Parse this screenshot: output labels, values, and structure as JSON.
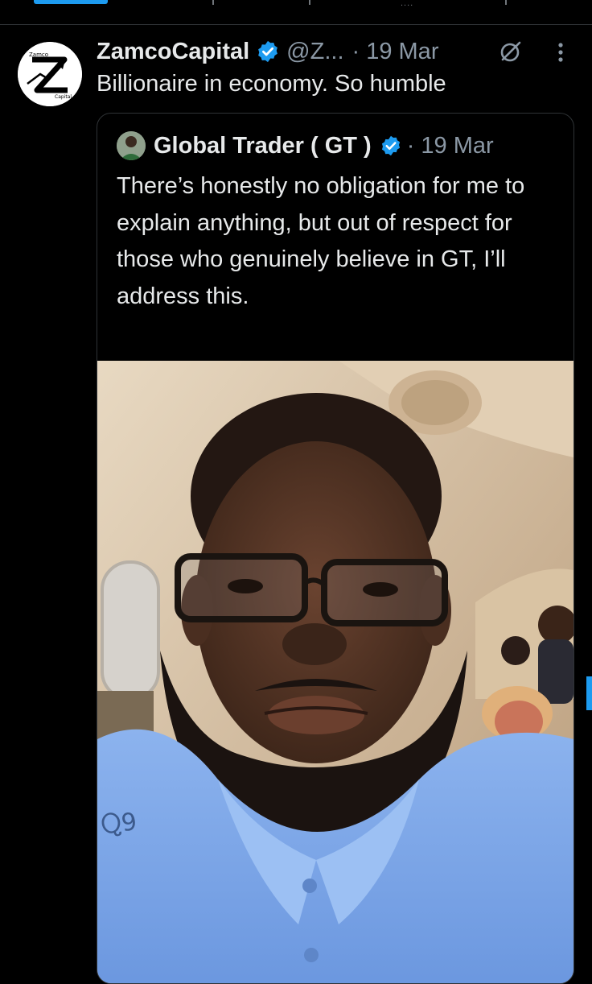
{
  "main_tweet": {
    "author_name": "ZamcoCapital",
    "handle": "@Z...",
    "timestamp": "· 19 Mar",
    "text": "Billionaire in economy. So humble"
  },
  "quoted_tweet": {
    "author_name": "Global Trader ( GT )",
    "timestamp": "· 19 Mar",
    "text": "There’s honestly no obligation for me to explain anything, but out of respect for those who genuinely believe in GT, I’ll address this.",
    "truncation": "...",
    "photo": {
      "shirt_logo": "Ⴍ9"
    }
  },
  "top_bar": {
    "more_dots": "...."
  },
  "icons": {
    "verified": "verified-badge-icon",
    "grok": "grok-icon",
    "more": "more-icon"
  },
  "colors": {
    "background": "#000000",
    "text": "#e7e9ea",
    "secondary_text": "#8b98a5",
    "accent": "#1d9bf0",
    "border": "#2f3336"
  }
}
